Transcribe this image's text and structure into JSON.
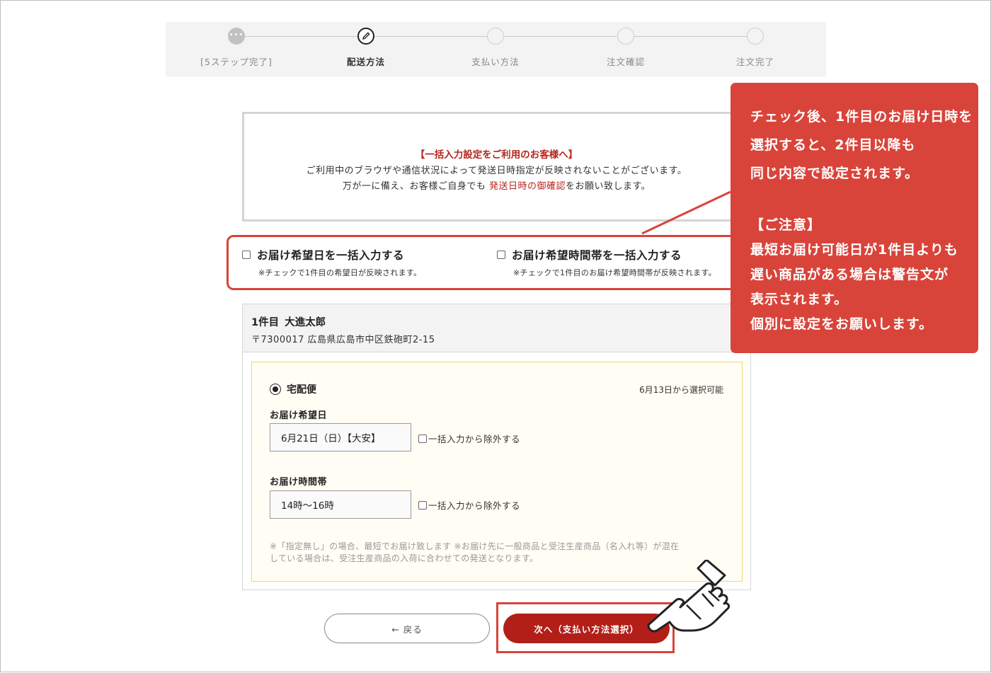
{
  "stepper": {
    "steps": [
      {
        "label": "[5ステップ完了]",
        "state": "done"
      },
      {
        "label": "配送方法",
        "state": "current"
      },
      {
        "label": "支払い方法",
        "state": "todo"
      },
      {
        "label": "注文確認",
        "state": "todo"
      },
      {
        "label": "注文完了",
        "state": "todo"
      }
    ]
  },
  "notice": {
    "title": "【一括入力設定をご利用のお客様へ】",
    "line1": "ご利用中のブラウザや通信状況によって発送日時指定が反映されないことがございます。",
    "line2_prefix": "万が一に備え、お客様ご自身でも",
    "line2_link": "発送日時の御確認",
    "line2_suffix": "をお願い致します。"
  },
  "bulk": {
    "date": {
      "label": "お届け希望日を一括入力する",
      "note": "※チェックで1件目の希望日が反映されます。",
      "checked": false
    },
    "time": {
      "label": "お届け希望時間帯を一括入力する",
      "note": "※チェックで1件目のお届け希望時間帯が反映されます。",
      "checked": false
    }
  },
  "recipient": {
    "index": "1件目",
    "name": "大進太郎",
    "address": "〒7300017 広島県広島市中区鉄砲町2-15",
    "method": "宅配便",
    "available_from": "6月13日から選択可能",
    "date_label": "お届け希望日",
    "date_value": "6月21日（日）【大安】",
    "time_label": "お届け時間帯",
    "time_value": "14時～16時",
    "exclude_label": "一括入力から除外する",
    "note_line1": "※「指定無し」の場合、最短でお届け致します ※お届け先に一般商品と受注生産商品（名入れ等）が混在",
    "note_line2": "している場合は、受注生産商品の入荷に合わせての発送となります。"
  },
  "buttons": {
    "back": "← 戻る",
    "next": "次へ（支払い方法選択）"
  },
  "callout": {
    "lines1": [
      "チェック後、1件目のお届け日時を",
      "選択すると、2件目以降も",
      "同じ内容で設定されます。"
    ],
    "lines2": [
      "【ご注意】",
      "最短お届け可能日が1件目よりも",
      "遅い商品がある場合は警告文が",
      "表示されます。",
      "個別に設定をお願いします。"
    ]
  },
  "colors": {
    "accent_red": "#b21f18",
    "callout_red": "#d9443a",
    "panel_bg": "#fffdf4",
    "panel_border": "#f0d873"
  }
}
